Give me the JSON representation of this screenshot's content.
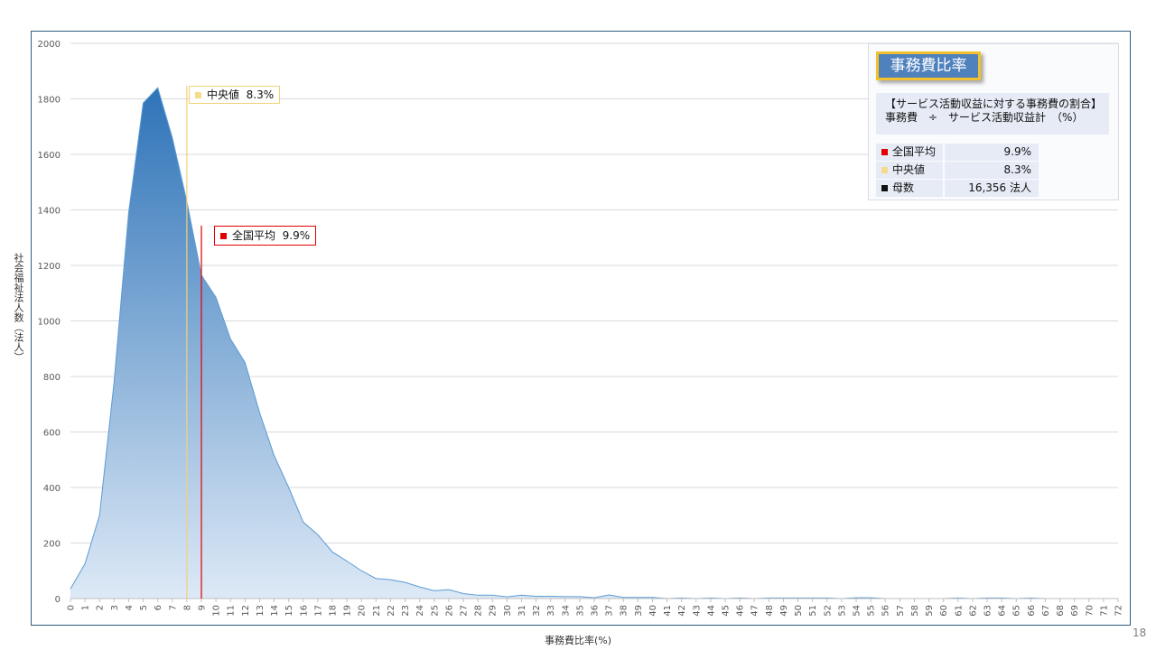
{
  "chart_data": {
    "type": "area",
    "xlabel": "事務費比率(%)",
    "ylabel": "社会福祉法人数（法人）",
    "ylim": [
      0,
      2000
    ],
    "yticks": [
      0,
      200,
      400,
      600,
      800,
      1000,
      1200,
      1400,
      1600,
      1800,
      2000
    ],
    "x": [
      0,
      1,
      2,
      3,
      4,
      5,
      6,
      7,
      8,
      9,
      10,
      11,
      12,
      13,
      14,
      15,
      16,
      17,
      18,
      19,
      20,
      21,
      22,
      23,
      24,
      25,
      26,
      27,
      28,
      29,
      30,
      31,
      32,
      33,
      34,
      35,
      36,
      37,
      38,
      39,
      40,
      41,
      42,
      43,
      44,
      45,
      46,
      47,
      48,
      49,
      50,
      51,
      52,
      53,
      54,
      55,
      56,
      57,
      58,
      59,
      60,
      61,
      62,
      63,
      64,
      65,
      66,
      67,
      68,
      69,
      70,
      71,
      72
    ],
    "values": [
      35,
      125,
      300,
      780,
      1390,
      1785,
      1840,
      1660,
      1430,
      1165,
      1085,
      935,
      850,
      670,
      515,
      400,
      275,
      230,
      168,
      135,
      100,
      72,
      68,
      58,
      42,
      28,
      32,
      18,
      12,
      12,
      6,
      12,
      8,
      8,
      7,
      7,
      3,
      13,
      4,
      4,
      4,
      0,
      2,
      0,
      2,
      0,
      2,
      0,
      2,
      2,
      2,
      2,
      2,
      0,
      3,
      3,
      0,
      0,
      0,
      0,
      0,
      2,
      0,
      2,
      2,
      0,
      2,
      0,
      0,
      0,
      0,
      0,
      0
    ],
    "grid": true,
    "colors": {
      "fill_top": "#2e73b8",
      "fill_bottom": "#dde9f6",
      "stroke": "#5b9bd5"
    },
    "markers": [
      {
        "label": "中央値",
        "value": 8.3,
        "value_text": "8.3%",
        "color": "#f5dc8c",
        "line_color": "#f1d27a"
      },
      {
        "label": "全国平均",
        "value": 9.9,
        "value_text": "9.9%",
        "color": "#e00000",
        "line_color": "#e00000"
      }
    ]
  },
  "panel": {
    "title": "事務費比率",
    "formula_line1": "【サービス活動収益に対する事務費の割合】",
    "formula_line2": "事務費　÷　サービス活動収益計　（%）",
    "rows": [
      {
        "label": "全国平均",
        "value": "9.9%",
        "color": "#e00000"
      },
      {
        "label": "中央値",
        "value": "8.3%",
        "color": "#f5dc8c"
      },
      {
        "label": "母数",
        "value": "16,356  法人",
        "color": "#111111"
      }
    ]
  },
  "callouts": {
    "median": {
      "label": "中央値",
      "value": "8.3%"
    },
    "mean": {
      "label": "全国平均",
      "value": "9.9%"
    }
  },
  "page_number": "18"
}
